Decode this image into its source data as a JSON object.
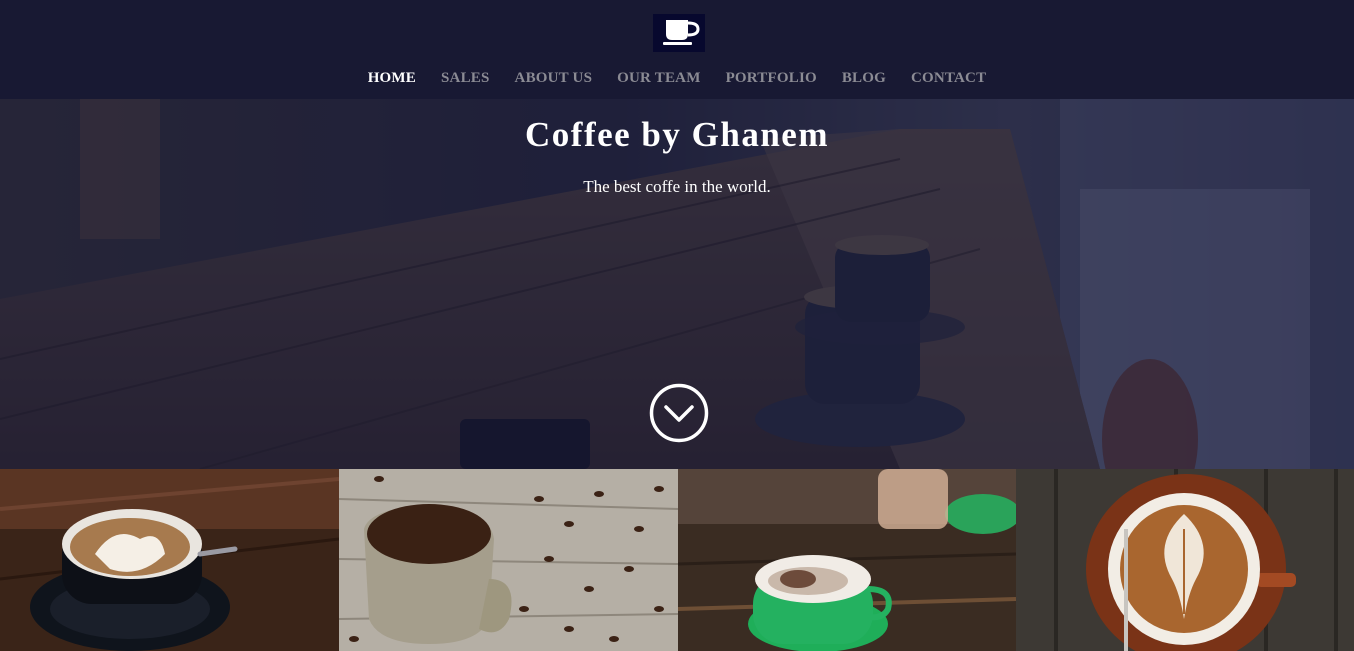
{
  "header": {
    "logo_icon": "coffee-cup-icon",
    "nav": [
      {
        "label": "HOME",
        "active": true
      },
      {
        "label": "SALES",
        "active": false
      },
      {
        "label": "ABOUT US",
        "active": false
      },
      {
        "label": "OUR TEAM",
        "active": false
      },
      {
        "label": "PORTFOLIO",
        "active": false
      },
      {
        "label": "BLOG",
        "active": false
      },
      {
        "label": "CONTACT",
        "active": false
      }
    ]
  },
  "hero": {
    "title": "Coffee by Ghanem",
    "subtitle": "The best coffe in the world.",
    "scroll_icon": "chevron-down-circle-icon"
  },
  "gallery": {
    "images": [
      "coffee-with-cream-photo",
      "coffee-beans-cup-photo",
      "green-cappuccino-cup-photo",
      "latte-art-photo"
    ]
  },
  "colors": {
    "header_bg": "#181933",
    "nav_active": "#ffffff",
    "nav_inactive": "#8b8b94",
    "overlay": "#16183a"
  }
}
